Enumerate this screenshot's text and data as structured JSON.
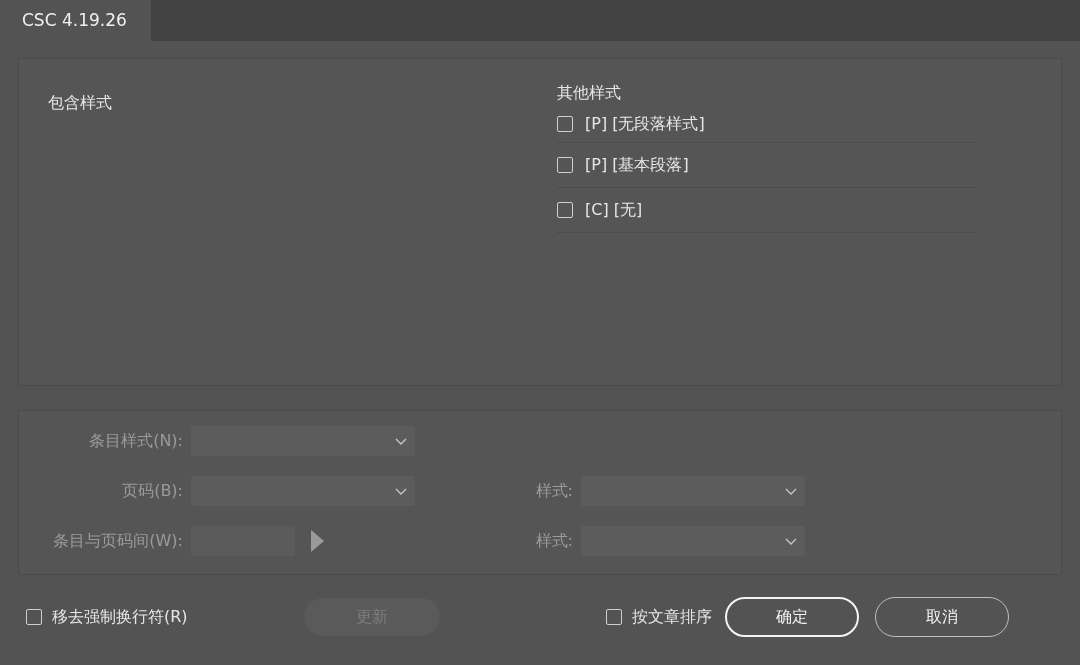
{
  "window": {
    "tab": "CSC 4.19.26"
  },
  "included_styles": {
    "heading": "包含样式"
  },
  "other_styles": {
    "heading": "其他样式",
    "items": [
      {
        "label": "[P] [无段落样式]",
        "checked": false
      },
      {
        "label": "[P] [基本段落]",
        "checked": false
      },
      {
        "label": "[C] [无]",
        "checked": false
      }
    ]
  },
  "entry_rows": [
    {
      "fields": [
        {
          "label": "条目样式(N):",
          "kind": "dropdown",
          "disabled": true
        }
      ]
    },
    {
      "fields": [
        {
          "label": "页码(B):",
          "kind": "dropdown",
          "disabled": true
        },
        {
          "label": "样式:",
          "kind": "dropdown",
          "disabled": true
        }
      ]
    },
    {
      "fields": [
        {
          "label": "条目与页码间(W):",
          "kind": "text-menu",
          "disabled": true
        },
        {
          "label": "样式:",
          "kind": "dropdown",
          "disabled": true
        }
      ]
    }
  ],
  "footer": {
    "remove_breaks": {
      "label": "移去强制换行符(R)",
      "checked": false
    },
    "update_button": {
      "label": "更新",
      "disabled": true
    },
    "sort_by_story": {
      "label": "按文章排序",
      "checked": false
    },
    "buttons": [
      {
        "label": "确定",
        "default": true
      },
      {
        "label": "取消",
        "default": false
      }
    ]
  }
}
